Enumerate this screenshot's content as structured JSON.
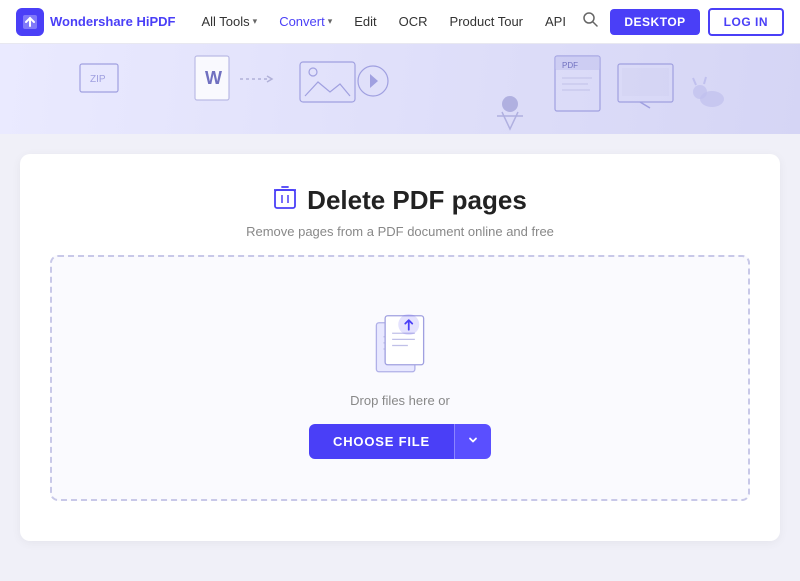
{
  "brand": {
    "name_part1": "Wondershare",
    "name_part2": "HiPDF",
    "logo_letter": "H"
  },
  "nav": {
    "items": [
      {
        "label": "All Tools",
        "has_dropdown": true
      },
      {
        "label": "Convert",
        "has_dropdown": true
      },
      {
        "label": "Edit",
        "has_dropdown": false
      },
      {
        "label": "OCR",
        "has_dropdown": false
      },
      {
        "label": "Product Tour",
        "has_dropdown": false
      },
      {
        "label": "API",
        "has_dropdown": false
      }
    ],
    "btn_desktop": "DESKTOP",
    "btn_login": "LOG IN"
  },
  "tool": {
    "title": "Delete PDF pages",
    "subtitle": "Remove pages from a PDF document online and free",
    "drop_text": "Drop files here or",
    "btn_choose_file": "CHOOSE FILE",
    "btn_dropdown_label": "▼"
  }
}
